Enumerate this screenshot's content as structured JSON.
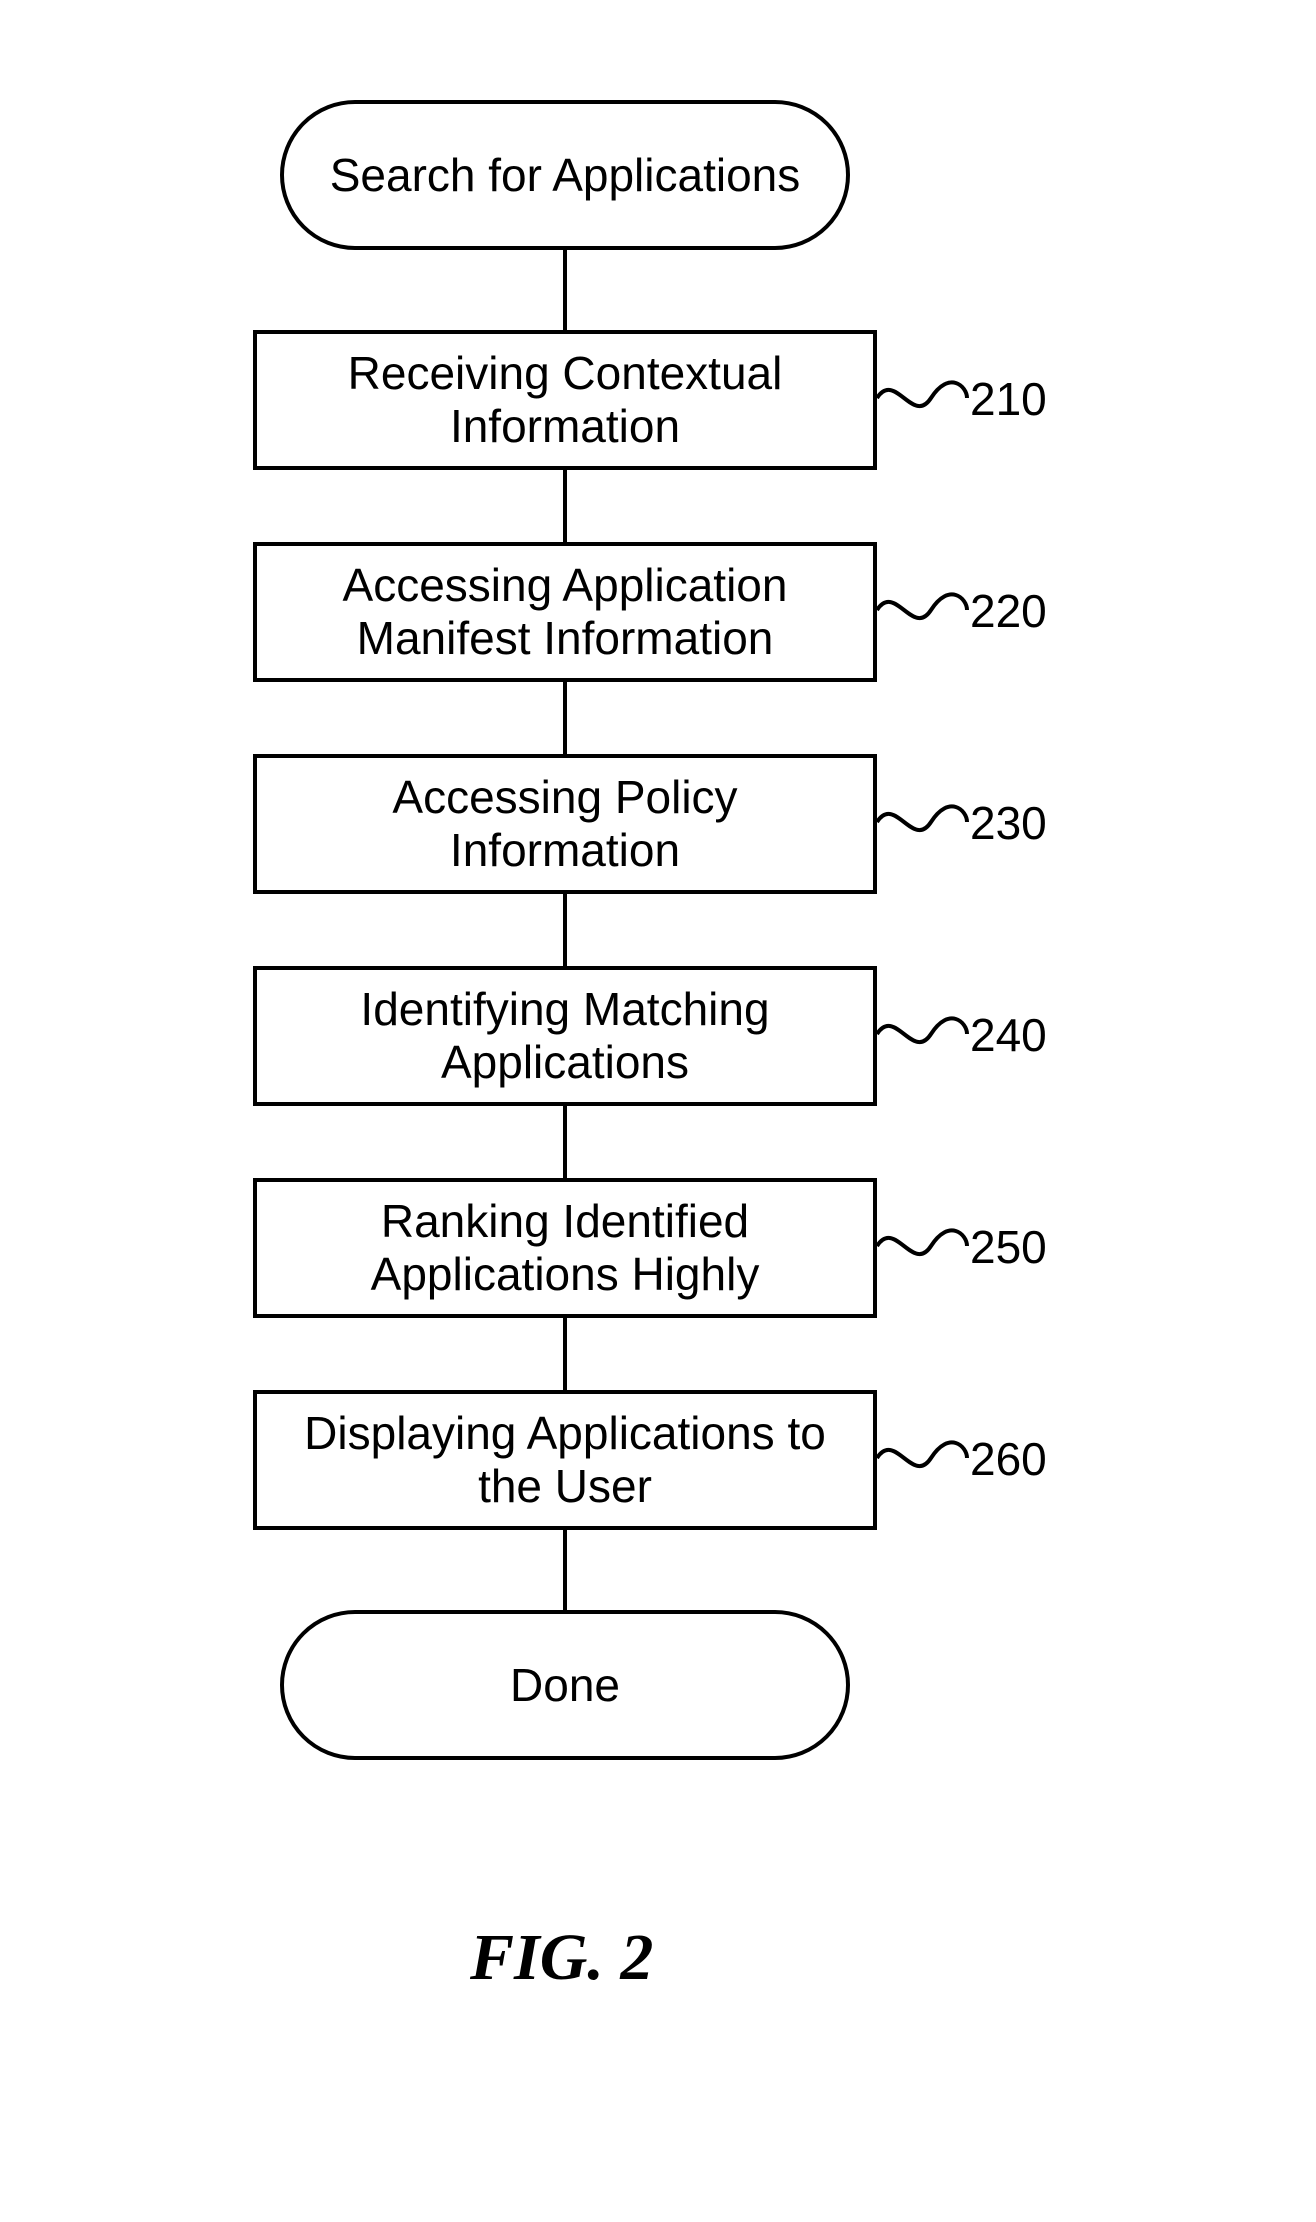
{
  "chart_data": {
    "type": "flowchart",
    "title": "FIG. 2",
    "nodes": [
      {
        "id": "start",
        "type": "terminal",
        "label": "Search for Applications"
      },
      {
        "id": "s210",
        "type": "process",
        "label": "Receiving Contextual Information",
        "ref": "210"
      },
      {
        "id": "s220",
        "type": "process",
        "label": "Accessing Application Manifest Information",
        "ref": "220"
      },
      {
        "id": "s230",
        "type": "process",
        "label": "Accessing Policy Information",
        "ref": "230"
      },
      {
        "id": "s240",
        "type": "process",
        "label": "Identifying Matching Applications",
        "ref": "240"
      },
      {
        "id": "s250",
        "type": "process",
        "label": "Ranking Identified Applications Highly",
        "ref": "250"
      },
      {
        "id": "s260",
        "type": "process",
        "label": "Displaying Applications to the User",
        "ref": "260"
      },
      {
        "id": "done",
        "type": "terminal",
        "label": "Done"
      }
    ],
    "edges": [
      [
        "start",
        "s210"
      ],
      [
        "s210",
        "s220"
      ],
      [
        "s220",
        "s230"
      ],
      [
        "s230",
        "s240"
      ],
      [
        "s240",
        "s250"
      ],
      [
        "s250",
        "s260"
      ],
      [
        "s260",
        "done"
      ]
    ]
  },
  "nodes": {
    "start": {
      "label": "Search for Applications"
    },
    "s210": {
      "label": "Receiving Contextual\nInformation",
      "ref": "210"
    },
    "s220": {
      "label": "Accessing Application\nManifest Information",
      "ref": "220"
    },
    "s230": {
      "label": "Accessing Policy\nInformation",
      "ref": "230"
    },
    "s240": {
      "label": "Identifying Matching\nApplications",
      "ref": "240"
    },
    "s250": {
      "label": "Ranking Identified\nApplications Highly",
      "ref": "250"
    },
    "s260": {
      "label": "Displaying Applications to\nthe User",
      "ref": "260"
    },
    "done": {
      "label": "Done"
    }
  },
  "figure_label": "FIG. 2"
}
